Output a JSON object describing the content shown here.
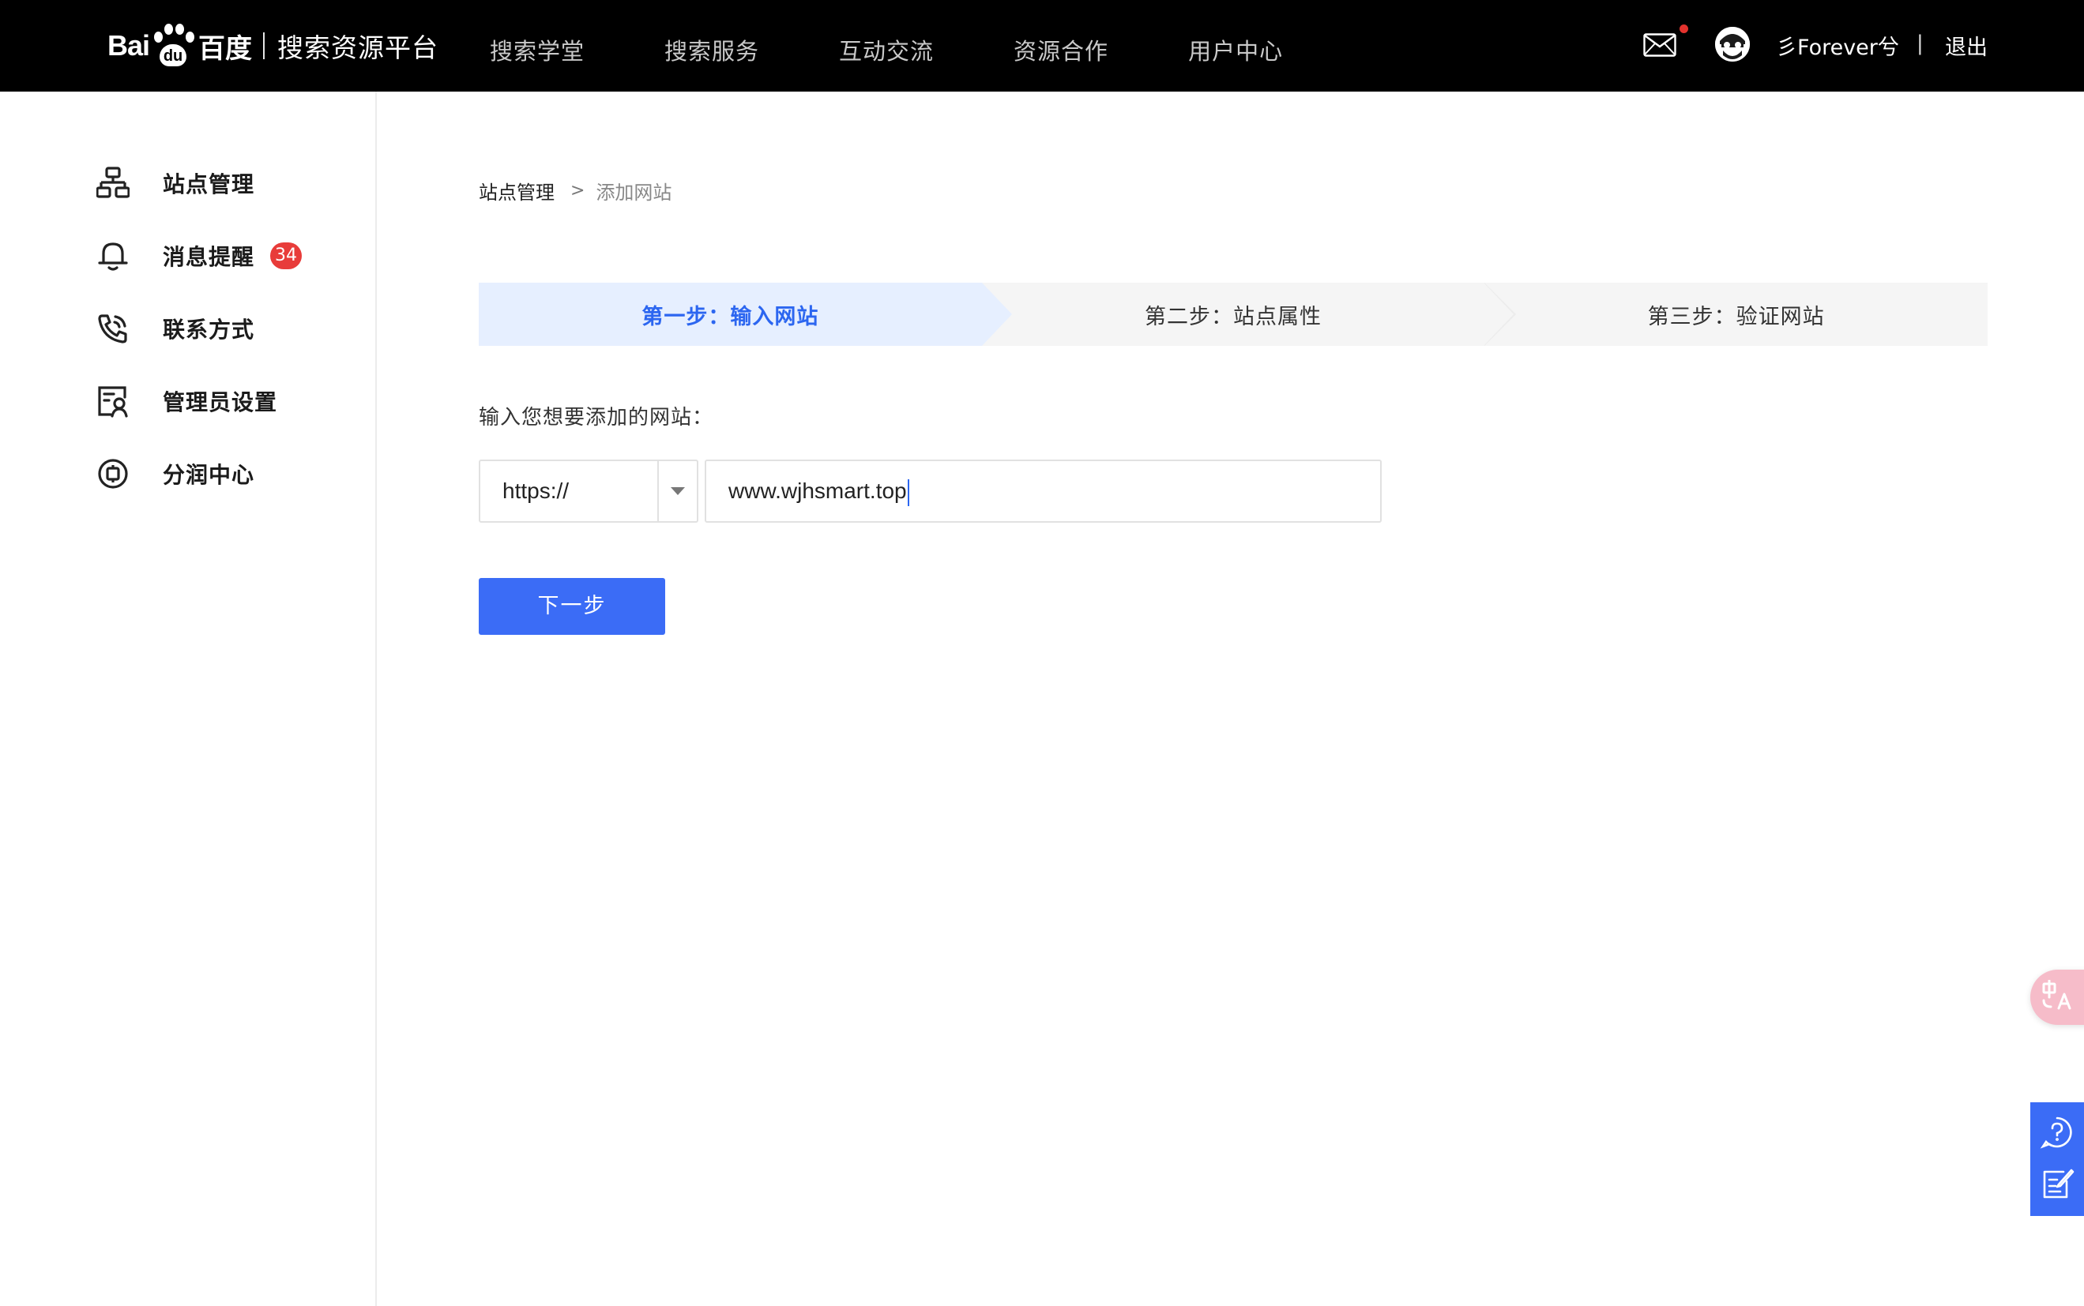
{
  "header": {
    "logo_text": "Bai",
    "logo_paw_text": "du",
    "logo_cn": "百度",
    "platform_name": "搜索资源平台",
    "nav": [
      {
        "label": "搜索学堂"
      },
      {
        "label": "搜索服务"
      },
      {
        "label": "互动交流"
      },
      {
        "label": "资源合作"
      },
      {
        "label": "用户中心"
      }
    ],
    "mail_icon": "mail-icon",
    "has_unread": true,
    "username": "彡Forever兮",
    "divider": "|",
    "logout_label": "退出"
  },
  "sidebar": {
    "items": [
      {
        "label": "站点管理",
        "icon": "sitemap-icon"
      },
      {
        "label": "消息提醒",
        "icon": "bell-icon",
        "badge": "34"
      },
      {
        "label": "联系方式",
        "icon": "phone-icon"
      },
      {
        "label": "管理员设置",
        "icon": "admin-icon"
      },
      {
        "label": "分润中心",
        "icon": "coin-icon"
      }
    ]
  },
  "breadcrumb": {
    "root": "站点管理",
    "separator": ">",
    "current": "添加网站"
  },
  "steps": [
    {
      "label": "第一步：输入网站",
      "active": true
    },
    {
      "label": "第二步：站点属性",
      "active": false
    },
    {
      "label": "第三步：验证网站",
      "active": false
    }
  ],
  "form": {
    "label": "输入您想要添加的网站：",
    "protocol": "https://",
    "url_value": "www.wjhsmart.top",
    "next_label": "下一步"
  },
  "colors": {
    "primary": "#3b6cf6",
    "active_step_bg": "#e6efff",
    "active_step_text": "#2c66f0",
    "badge": "#e83c3a",
    "topbar": "#000000"
  },
  "floating": {
    "translate_icon": "translate-icon",
    "help_icon": "help-icon",
    "feedback_icon": "feedback-icon"
  }
}
